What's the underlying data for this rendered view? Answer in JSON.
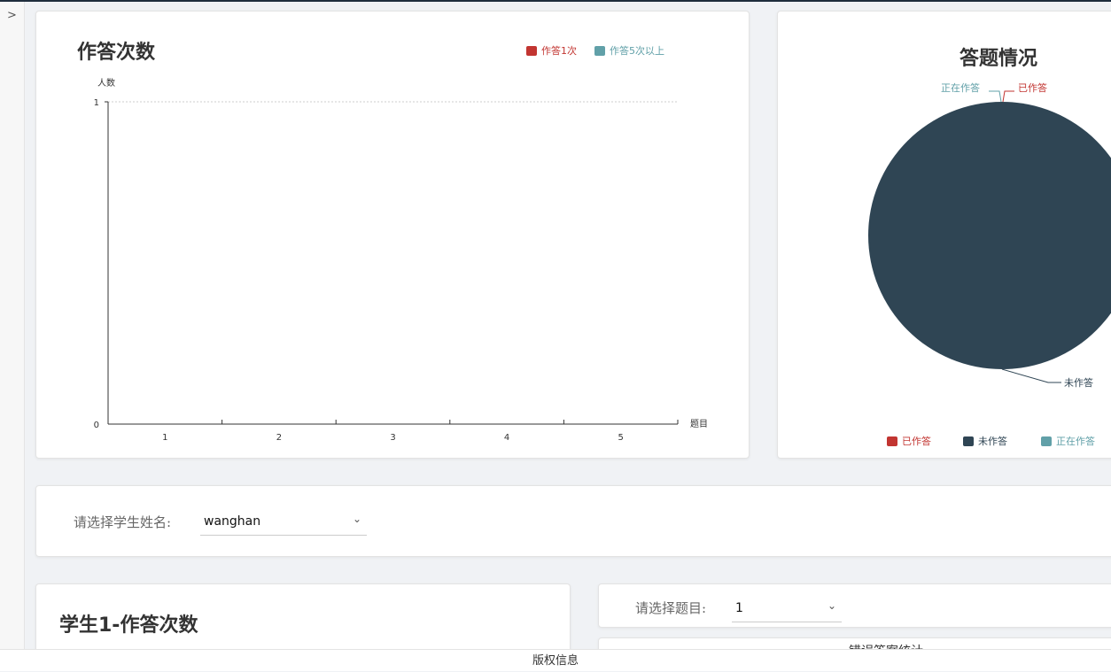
{
  "footer": {
    "text": "版权信息"
  },
  "charts": {
    "attempts": {
      "title": "作答次数",
      "legend": [
        {
          "label": "作答1次",
          "color": "#c23531"
        },
        {
          "label": "作答5次以上",
          "color": "#61a0a8"
        }
      ]
    },
    "answers": {
      "title": "答题情况",
      "legend": [
        {
          "label": "已作答",
          "color": "#c23531"
        },
        {
          "label": "未作答",
          "color": "#2f4554"
        },
        {
          "label": "正在作答",
          "color": "#61a0a8"
        }
      ]
    }
  },
  "chart_data": [
    {
      "type": "bar",
      "title": "作答次数",
      "xlabel": "题目",
      "ylabel": "人数",
      "categories": [
        "1",
        "2",
        "3",
        "4",
        "5"
      ],
      "series": [
        {
          "name": "作答1次",
          "values": [
            0,
            0,
            0,
            0,
            0
          ]
        },
        {
          "name": "作答5次以上",
          "values": [
            0,
            0,
            0,
            0,
            0
          ]
        }
      ],
      "ylim": [
        0,
        1
      ],
      "yticks": [
        "0",
        "1"
      ],
      "legend": "top-right"
    },
    {
      "type": "pie",
      "title": "答题情况",
      "labels": [
        "已作答",
        "未作答",
        "正在作答"
      ],
      "values": [
        0,
        1,
        0
      ],
      "legend": "bottom"
    }
  ],
  "student_select": {
    "label": "请选择学生姓名:",
    "value": "wanghan"
  },
  "student_card": {
    "title": "学生1-作答次数"
  },
  "question_select": {
    "label": "请选择题目:",
    "value": "1"
  },
  "error_card": {
    "title": "错误答案统计"
  }
}
